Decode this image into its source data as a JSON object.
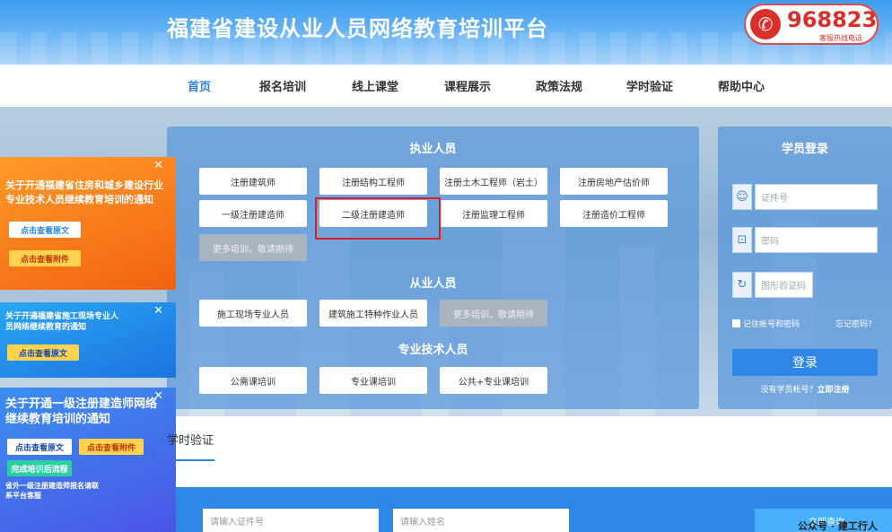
{
  "header": {
    "title": "福建省建设从业人员网络教育培训平台",
    "hotline_number": "968823",
    "hotline_caption": "客服热线电话"
  },
  "nav": {
    "items": [
      "首页",
      "报名培训",
      "线上课堂",
      "课程展示",
      "政策法规",
      "学时验证",
      "帮助中心"
    ],
    "active": "首页"
  },
  "catalog": {
    "section1_title": "执业人员",
    "section1_buttons": [
      "注册建筑师",
      "注册结构工程师",
      "注册土木工程师（岩土）",
      "注册房地产估价师",
      "一级注册建造师",
      "二级注册建造师",
      "注册监理工程师",
      "注册造价工程师"
    ],
    "section1_more": "更多培训，敬请期待",
    "section2_title": "从业人员",
    "section2_buttons": [
      "施工现场专业人员",
      "建筑施工特种作业人员"
    ],
    "section2_more": "更多培训，敬请期待",
    "section3_title": "专业技术人员",
    "section3_buttons": [
      "公需课培训",
      "专业课培训",
      "公共+专业课培训"
    ]
  },
  "login": {
    "title": "学员登录",
    "id_placeholder": "证件号",
    "password_placeholder": "密码",
    "captcha_placeholder": "图形验证码",
    "remember_label": "记住帐号和密码",
    "forgot_label": "忘记密码?",
    "submit_label": "登录",
    "register_prompt": "没有学员帐号？",
    "register_link": "立即注册"
  },
  "ads": {
    "ad1_text": "关于开通福建省住房和城乡建设行业专业技术人员继续教育培训的通知",
    "ad1_btn1": "点击查看原文",
    "ad1_btn2": "点击查看附件",
    "ad2_text": "关于开通福建省施工现场专业人员网络继续教育的通知",
    "ad2_btn1": "点击查看原文",
    "ad3_text": "关于开通一级注册建造师网络继续教育培训的通知",
    "ad3_btn1": "点击查看原文",
    "ad3_btn2": "点击查看附件",
    "ad3_btn3": "完成培训后流程",
    "ad3_note": "省外一级注册建造师报名请联系平台客服"
  },
  "verify": {
    "tab_label": "学时验证",
    "id_placeholder": "请输入证件号",
    "name_placeholder": "请输入姓名",
    "submit_label": "立即查询"
  },
  "watermark": "公众号 · 建工行人",
  "colors": {
    "accent": "#2e86e6",
    "highlight_box": "#e11e1e",
    "hotline": "#d9302c"
  }
}
